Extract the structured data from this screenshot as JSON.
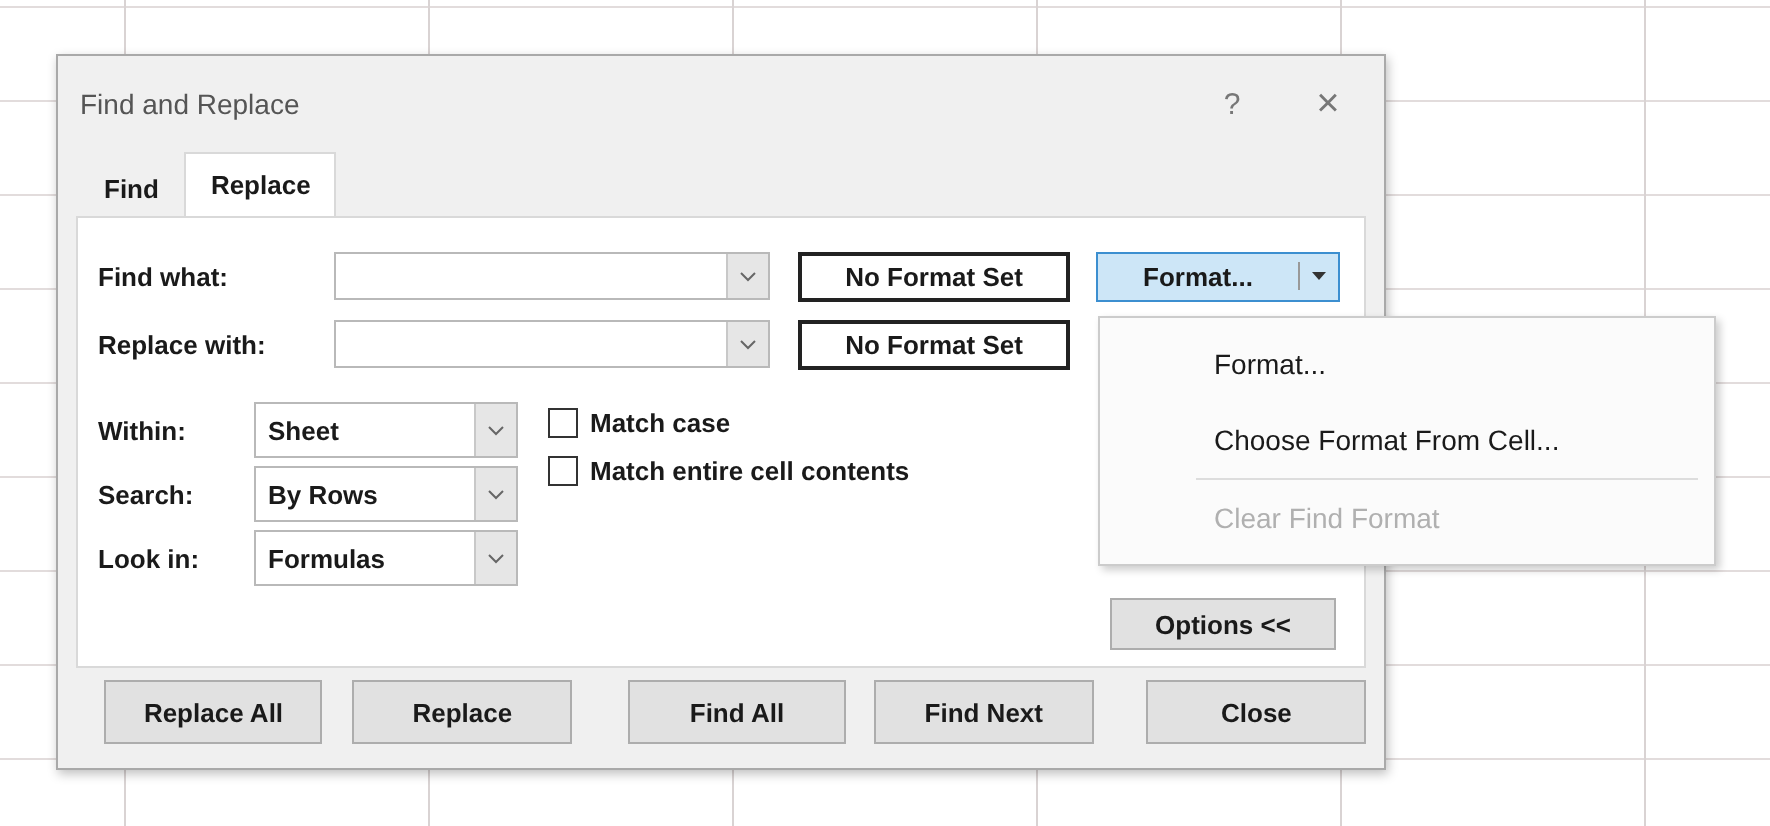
{
  "window": {
    "title": "Find and Replace",
    "help": "?",
    "close": "×"
  },
  "tabs": [
    {
      "label": "Find",
      "selected": false
    },
    {
      "label": "Replace",
      "selected": true
    }
  ],
  "fields": [
    {
      "label": "Find what:",
      "format_preview": "No Format Set"
    },
    {
      "label": "Replace with:",
      "format_preview": "No Format Set"
    }
  ],
  "format_button": {
    "label": "Format...",
    "expanded": true
  },
  "format_menu": [
    {
      "label": "Format...",
      "disabled": false,
      "separator_before": false
    },
    {
      "label": "Choose Format From Cell...",
      "disabled": false,
      "separator_before": false
    },
    {
      "label": "Clear Find Format",
      "disabled": true,
      "separator_before": true
    }
  ],
  "options": [
    {
      "label": "Within:",
      "value": "Sheet"
    },
    {
      "label": "Search:",
      "value": "By Rows"
    },
    {
      "label": "Look in:",
      "value": "Formulas"
    }
  ],
  "checkboxes": [
    {
      "label": "Match case",
      "checked": false
    },
    {
      "label": "Match entire cell contents",
      "checked": false
    }
  ],
  "options_button": "Options <<",
  "buttons": [
    "Replace All",
    "Replace",
    "Find All",
    "Find Next",
    "Close"
  ]
}
